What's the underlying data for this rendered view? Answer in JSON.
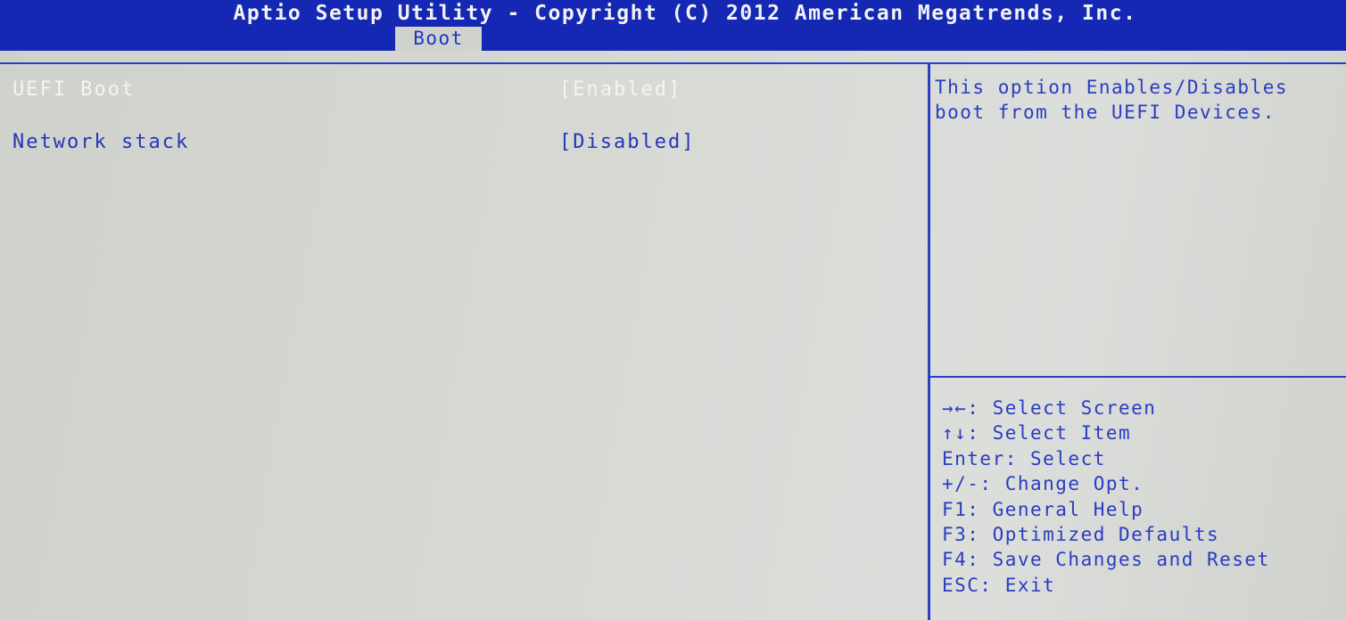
{
  "header": {
    "title": "Aptio Setup Utility - Copyright (C) 2012 American Megatrends, Inc.",
    "active_tab": "Boot"
  },
  "settings": [
    {
      "label": "UEFI Boot",
      "value": "[Enabled]"
    },
    {
      "label": "Network stack",
      "value": "[Disabled]"
    }
  ],
  "help": {
    "lines": [
      "This option Enables/Disables",
      "boot from the UEFI Devices."
    ]
  },
  "key_legend": [
    "→←: Select Screen",
    "↑↓: Select Item",
    "Enter: Select",
    "+/-: Change Opt.",
    "F1: General Help",
    "F3: Optimized Defaults",
    "F4: Save Changes and Reset",
    "ESC: Exit"
  ],
  "colors": {
    "header_bg": "#1428b4",
    "body_bg": "#d2d4d0",
    "accent": "#2a3cc2",
    "highlight_text": "#f4f4f4"
  }
}
